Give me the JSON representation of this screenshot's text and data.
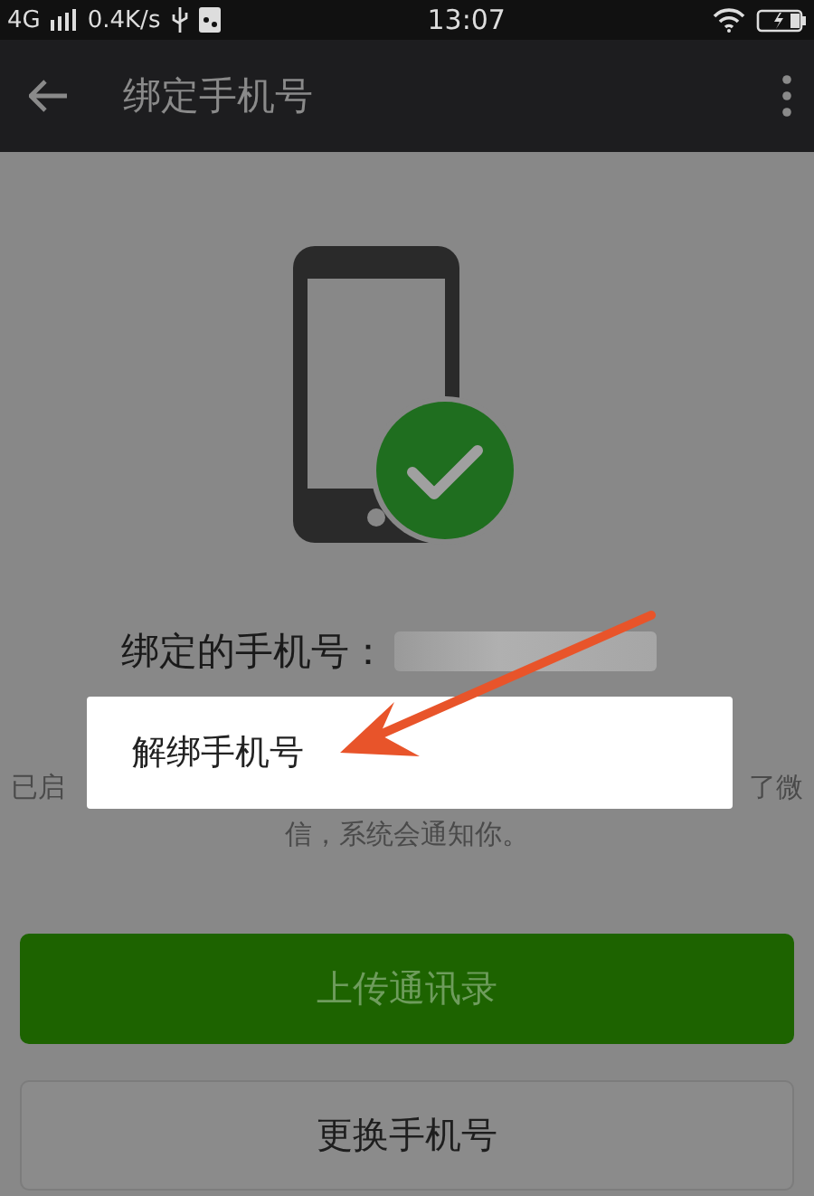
{
  "status_bar": {
    "network": "4G",
    "speed": "0.4K/s",
    "time": "13:07"
  },
  "app_bar": {
    "title": "绑定手机号"
  },
  "bound_number": {
    "label": "绑定的手机号："
  },
  "notice": {
    "line_1_start": "已启",
    "line_1_end": "了微",
    "line_2": "信，系统会通知你。"
  },
  "buttons": [
    {
      "label": "上传通讯录",
      "kind": "primary"
    },
    {
      "label": "更换手机号",
      "kind": "secondary"
    }
  ],
  "popup_menu": {
    "items": [
      {
        "label": "解绑手机号"
      }
    ]
  }
}
